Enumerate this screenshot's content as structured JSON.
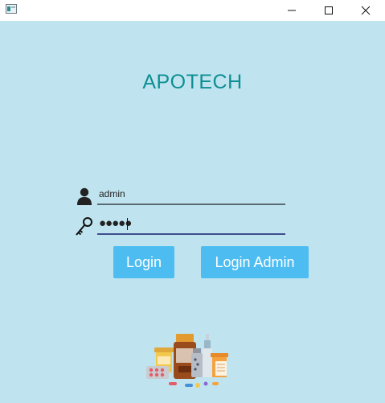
{
  "window": {
    "minimize_glyph": "—",
    "maximize_glyph": "☐",
    "close_glyph": "✕"
  },
  "brand": {
    "title": "APOTECH"
  },
  "form": {
    "username_value": "admin",
    "password_masked": "●●●●●"
  },
  "buttons": {
    "login_label": "Login",
    "login_admin_label": "Login Admin"
  },
  "icons": {
    "user": "user-icon",
    "key": "key-icon",
    "illustration": "medicines-illustration"
  },
  "colors": {
    "background": "#c0e4ef",
    "brand": "#0d8f93",
    "button": "#4dbdf1"
  }
}
